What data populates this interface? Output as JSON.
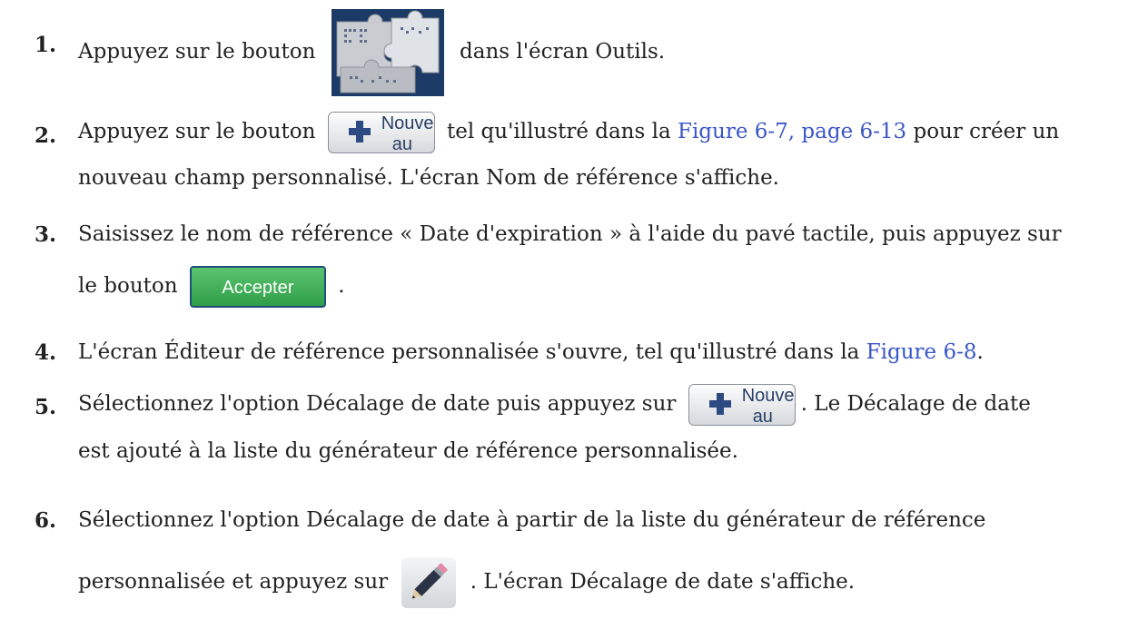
{
  "steps": [
    {
      "num": "1.",
      "before": "Appuyez sur le bouton",
      "after": "dans l'écran Outils."
    },
    {
      "num": "2.",
      "before": "Appuyez sur le bouton",
      "after": "tel qu'illustré dans la",
      "link": "Figure 6-7, page 6-13",
      "after2": "pour créer un",
      "line2": "nouveau champ personnalisé. L'écran Nom de référence s'affiche."
    },
    {
      "num": "3.",
      "line1": "Saisissez le nom de référence « Date d'expiration » à l'aide du pavé tactile, puis appuyez sur",
      "before": "le bouton",
      "after": "."
    },
    {
      "num": "4.",
      "before": "L'écran Éditeur de référence personnalisée s'ouvre, tel qu'illustré dans la",
      "link": "Figure 6-8",
      "after": "."
    },
    {
      "num": "5.",
      "before": "Sélectionnez l'option Décalage de date puis appuyez sur",
      "after": ". Le Décalage de date",
      "line2": "est ajouté à la liste du générateur de référence personnalisée."
    },
    {
      "num": "6.",
      "line1": "Sélectionnez l'option Décalage de date à partir de la liste du générateur de référence",
      "before": "personnalisée et appuyez sur",
      "after": ". L'écran Décalage de date s'affiche."
    }
  ],
  "buttons": {
    "new_line1": "Nouve",
    "new_line2": "au",
    "accept": "Accepter"
  },
  "icons": {
    "tools": "puzzle-icon",
    "add": "plus-icon",
    "edit": "pencil-icon"
  },
  "colors": {
    "link": "#3a56c8",
    "accept": "#3aa852"
  }
}
